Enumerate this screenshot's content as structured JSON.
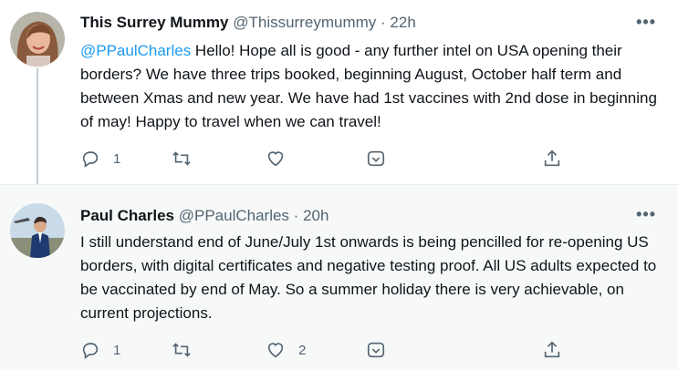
{
  "tweets": [
    {
      "author_name": "This Surrey Mummy",
      "handle": "@Thissurreymummy",
      "separator": "·",
      "time": "22h",
      "mention": "@PPaulCharles",
      "text": " Hello! Hope all is good - any further intel on USA opening their borders? We have three trips booked, beginning August, October half term and between Xmas and new year. We have had 1st vaccines with 2nd dose in beginning of may! Happy to travel when we can travel!",
      "reply_count": "1",
      "retweet_count": "",
      "like_count": "",
      "more_label": "•••"
    },
    {
      "author_name": "Paul Charles",
      "handle": "@PPaulCharles",
      "separator": "·",
      "time": "20h",
      "text": "I still understand end of June/July 1st onwards is being pencilled for re-opening US borders, with digital certificates and negative testing proof. All US adults expected to be vaccinated by end of May. So a summer holiday there is very achievable, on current projections.",
      "reply_count": "1",
      "retweet_count": "",
      "like_count": "2",
      "more_label": "•••"
    }
  ],
  "icons": {
    "reply": "reply-icon",
    "retweet": "retweet-icon",
    "like": "heart-icon",
    "more": "chevron-down-icon",
    "share": "share-icon"
  },
  "colors": {
    "text": "#0f1419",
    "secondary": "#536471",
    "link": "#1d9bf0",
    "thread_line": "#c4cfd6",
    "hover_bg": "#f7f9f9"
  }
}
